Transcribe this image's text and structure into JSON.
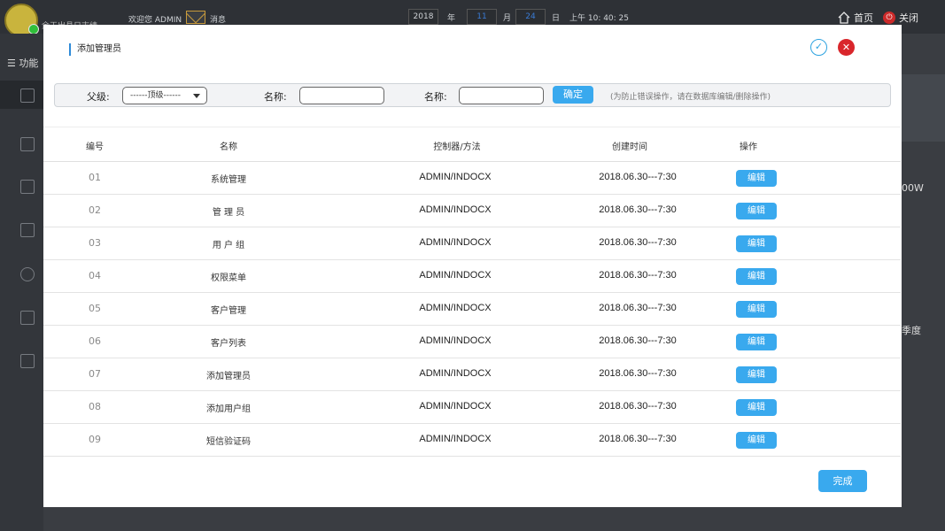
{
  "background": {
    "system_name": "余干出县日志绩",
    "welcome": "欢迎您 ADMIN",
    "messages_label": "消息",
    "date": {
      "year": "2018",
      "year_unit": "年",
      "month": "11",
      "month_unit": "月",
      "day": "24",
      "day_unit": "日",
      "time": "上午 10: 40: 25"
    },
    "home_label": "首页",
    "close_label": "关闭",
    "menu_label": "功能",
    "right_text_1": "00W",
    "right_text_2": "季度"
  },
  "modal": {
    "title": "添加管理员",
    "filter": {
      "parent_label": "父级:",
      "parent_selected": "------顶级------",
      "name_label_1": "名称:",
      "name_value_1": "",
      "name_label_2": "名称:",
      "name_value_2": "",
      "confirm_label": "确定",
      "hint": "(为防止错误操作，请在数据库编辑/删除操作)"
    },
    "table": {
      "headers": [
        "编号",
        "名称",
        "控制器/方法",
        "创建时间",
        "操作"
      ],
      "rows": [
        {
          "no": "01",
          "name": "系统管理",
          "ctrl": "ADMIN/INDOCX",
          "time": "2018.06.30---7:30",
          "action": "编辑"
        },
        {
          "no": "02",
          "name": "管 理 员",
          "ctrl": "ADMIN/INDOCX",
          "time": "2018.06.30---7:30",
          "action": "编辑"
        },
        {
          "no": "03",
          "name": "用 户 组",
          "ctrl": "ADMIN/INDOCX",
          "time": "2018.06.30---7:30",
          "action": "编辑"
        },
        {
          "no": "04",
          "name": "权限菜单",
          "ctrl": "ADMIN/INDOCX",
          "time": "2018.06.30---7:30",
          "action": "编辑"
        },
        {
          "no": "05",
          "name": "客户管理",
          "ctrl": "ADMIN/INDOCX",
          "time": "2018.06.30---7:30",
          "action": "编辑"
        },
        {
          "no": "06",
          "name": "客户列表",
          "ctrl": "ADMIN/INDOCX",
          "time": "2018.06.30---7:30",
          "action": "编辑"
        },
        {
          "no": "07",
          "name": "添加管理员",
          "ctrl": "ADMIN/INDOCX",
          "time": "2018.06.30---7:30",
          "action": "编辑"
        },
        {
          "no": "08",
          "name": "添加用户组",
          "ctrl": "ADMIN/INDOCX",
          "time": "2018.06.30---7:30",
          "action": "编辑"
        },
        {
          "no": "09",
          "name": "短信验证码",
          "ctrl": "ADMIN/INDOCX",
          "time": "2018.06.30---7:30",
          "action": "编辑"
        }
      ]
    },
    "done_label": "完成"
  },
  "colors": {
    "accent": "#39a9ee",
    "close_red": "#d9262b",
    "overlay": "#3a3d42"
  }
}
